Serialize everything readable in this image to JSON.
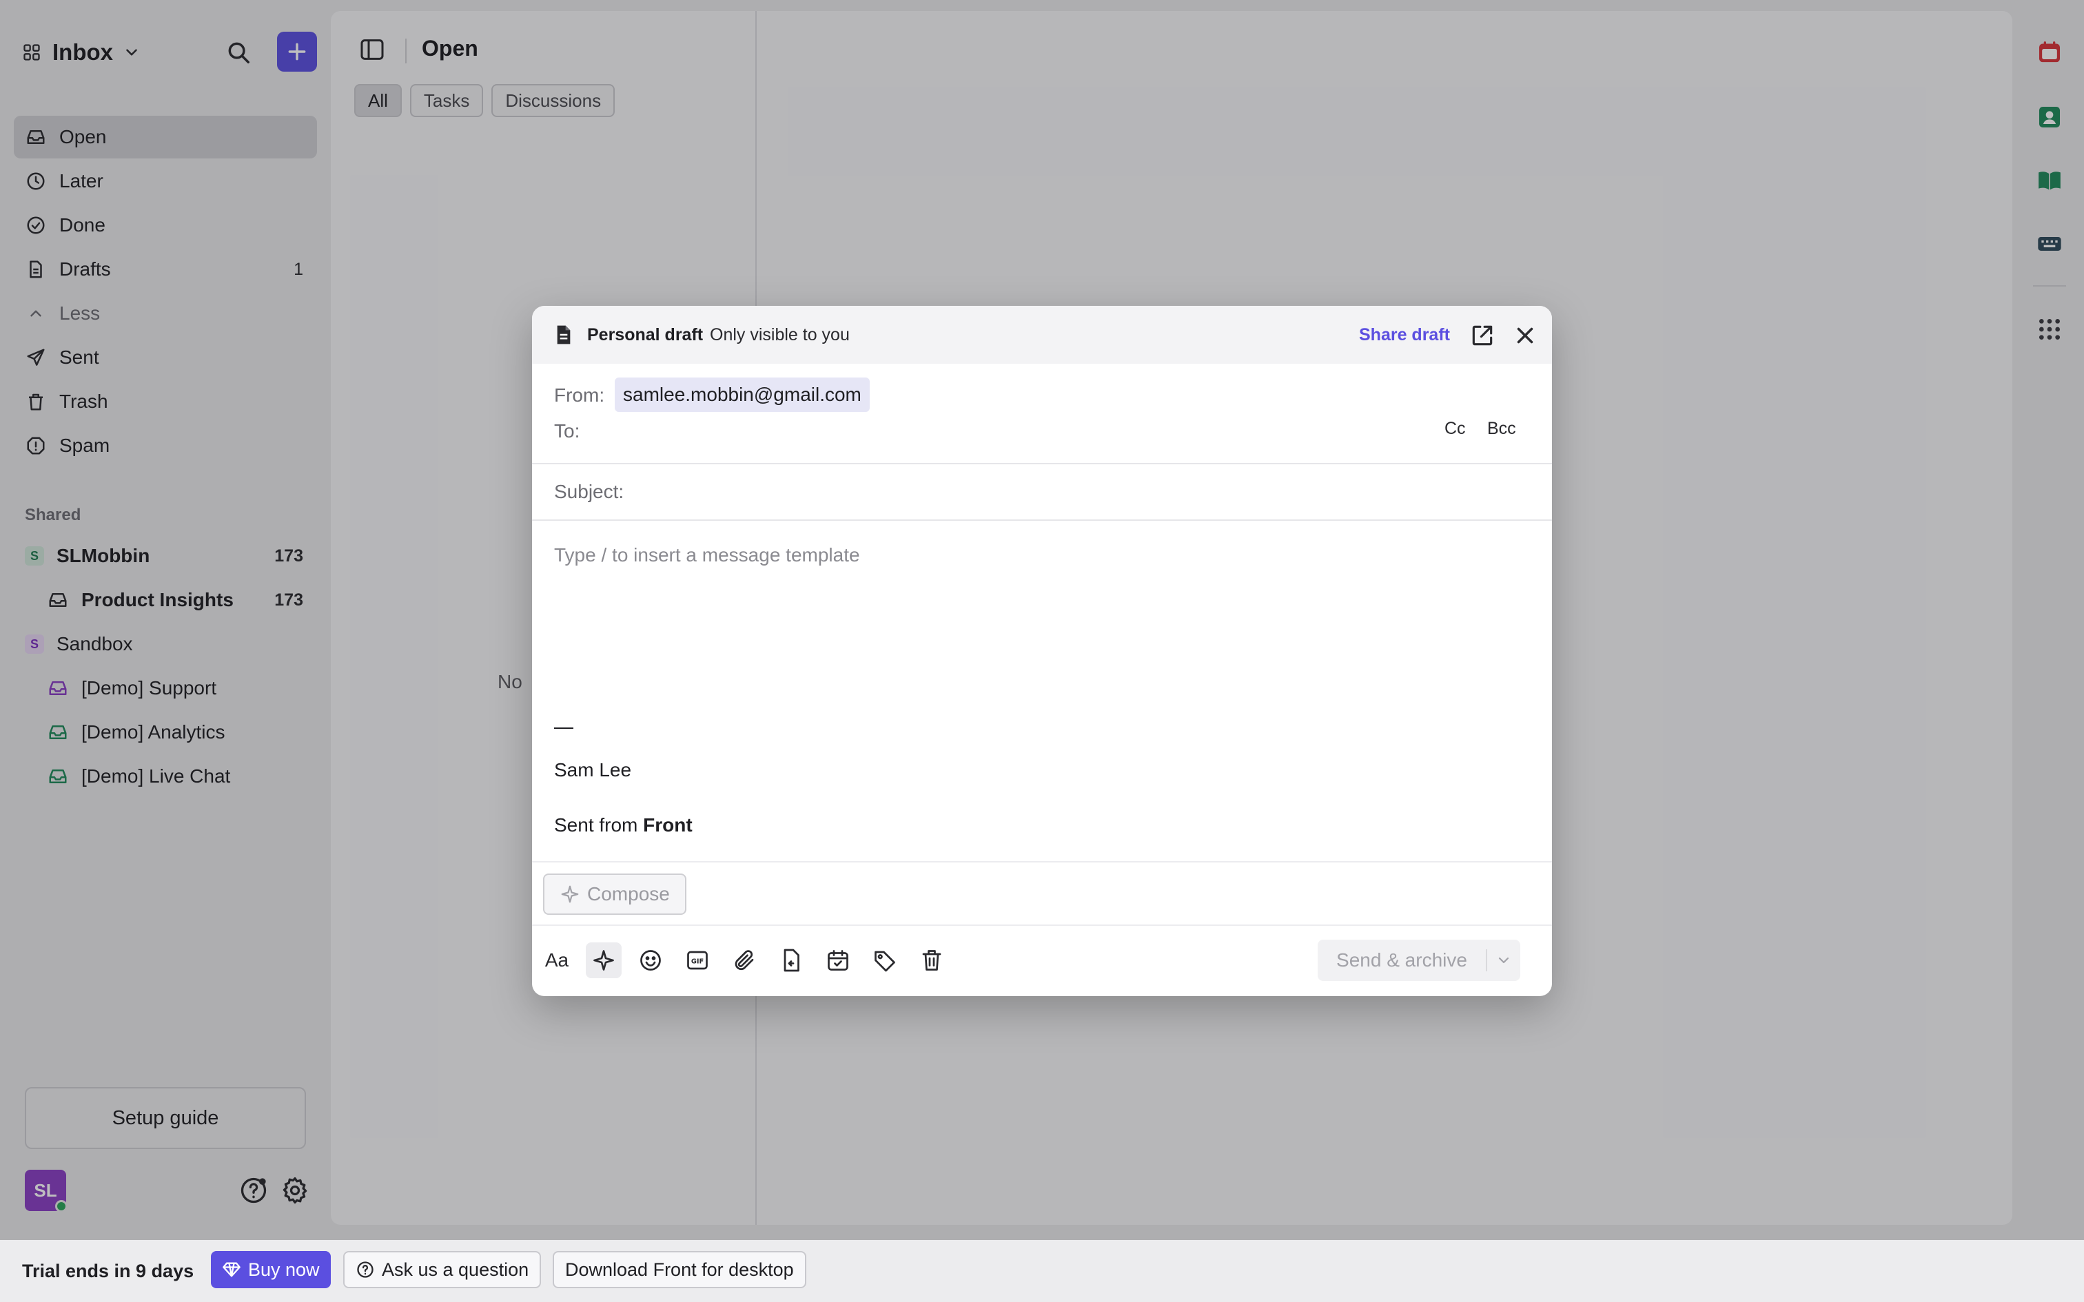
{
  "sidebar": {
    "inbox_label": "Inbox",
    "nav": [
      {
        "label": "Open",
        "count": ""
      },
      {
        "label": "Later",
        "count": ""
      },
      {
        "label": "Done",
        "count": ""
      },
      {
        "label": "Drafts",
        "count": "1"
      },
      {
        "label": "Less",
        "count": ""
      },
      {
        "label": "Sent",
        "count": ""
      },
      {
        "label": "Trash",
        "count": ""
      },
      {
        "label": "Spam",
        "count": ""
      }
    ],
    "shared_label": "Shared",
    "shared": [
      {
        "label": "SLMobbin",
        "count": "173",
        "badge": "S"
      },
      {
        "label": "Product Insights",
        "count": "173"
      },
      {
        "label": "Sandbox",
        "count": "",
        "badge": "S"
      },
      {
        "label": "[Demo] Support",
        "count": ""
      },
      {
        "label": "[Demo] Analytics",
        "count": ""
      },
      {
        "label": "[Demo] Live Chat",
        "count": ""
      }
    ],
    "setup_guide": "Setup guide",
    "avatar_initials": "SL"
  },
  "list": {
    "title": "Open",
    "chips": [
      "All",
      "Tasks",
      "Discussions"
    ],
    "empty_text": "No"
  },
  "modal": {
    "title": "Personal draft",
    "subtitle": "Only visible to you",
    "share_draft": "Share draft",
    "from_label": "From:",
    "from_value": "samlee.mobbin@gmail.com",
    "to_label": "To:",
    "cc": "Cc",
    "bcc": "Bcc",
    "subject_label": "Subject:",
    "body_placeholder": "Type / to insert a message template",
    "signature_dash": "—",
    "signature_name": "Sam Lee",
    "sent_from": "Sent from",
    "sent_from_brand": "Front",
    "compose_label": "Compose",
    "format_label": "Aa",
    "send_label": "Send & archive"
  },
  "bottombar": {
    "trial": "Trial ends in 9 days",
    "buy_now": "Buy now",
    "ask": "Ask us a question",
    "download": "Download Front for desktop"
  },
  "colors": {
    "accent": "#5b4fe0",
    "rail_red": "#d8343a",
    "rail_green": "#1f8a5b",
    "avatar": "#8a3fc4"
  },
  "icons": {
    "rail": [
      "calendar-icon",
      "contacts-icon",
      "knowledge-book-icon",
      "keyboard-icon",
      "apps-grid-icon"
    ],
    "toolbar": [
      "format-icon",
      "ai-sparkle-icon",
      "emoji-icon",
      "gif-icon",
      "attach-icon",
      "reply-template-icon",
      "schedule-icon",
      "tag-icon",
      "trash-icon"
    ]
  }
}
